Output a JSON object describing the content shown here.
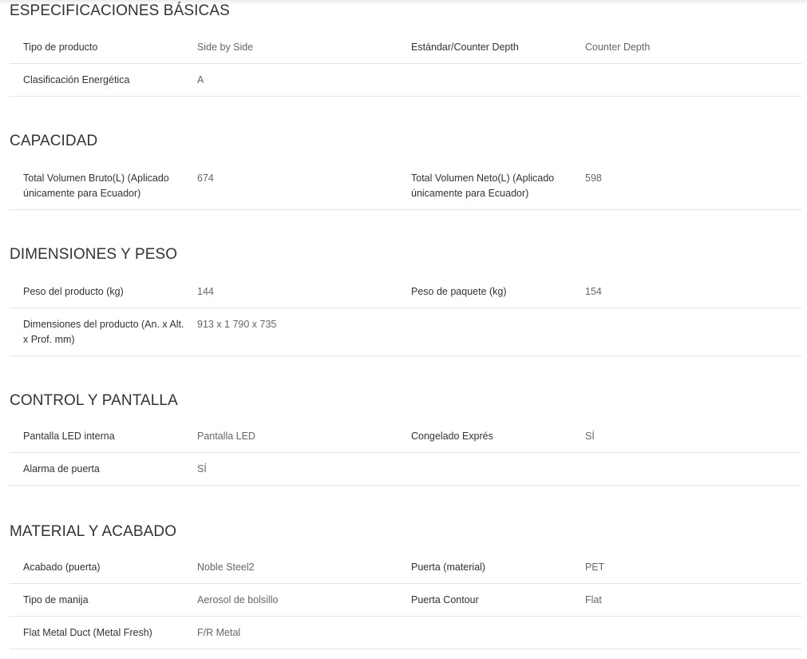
{
  "sections": [
    {
      "title": "ESPECIFICACIONES BÁSICAS",
      "rows": [
        {
          "l1": "Tipo de producto",
          "v1": "Side by Side",
          "l2": "Estándar/Counter Depth",
          "v2": "Counter Depth"
        },
        {
          "l1": "Clasificación Energética",
          "v1": "A"
        }
      ]
    },
    {
      "title": "CAPACIDAD",
      "rows": [
        {
          "l1": "Total Volumen Bruto(L) (Aplicado únicamente para Ecuador)",
          "v1": "674",
          "l2": "Total Volumen Neto(L) (Aplicado únicamente para Ecuador)",
          "v2": "598"
        }
      ]
    },
    {
      "title": "DIMENSIONES Y PESO",
      "rows": [
        {
          "l1": "Peso del producto (kg)",
          "v1": "144",
          "l2": "Peso de paquete (kg)",
          "v2": "154"
        },
        {
          "l1": "Dimensiones del producto (An. x Alt. x Prof. mm)",
          "v1": "913 x 1 790 x 735"
        }
      ]
    },
    {
      "title": "CONTROL Y PANTALLA",
      "rows": [
        {
          "l1": "Pantalla LED interna",
          "v1": "Pantalla LED",
          "l2": "Congelado Exprés",
          "v2": "SÍ"
        },
        {
          "l1": "Alarma de puerta",
          "v1": "SÍ"
        }
      ]
    },
    {
      "title": "MATERIAL Y ACABADO",
      "rows": [
        {
          "l1": "Acabado (puerta)",
          "v1": "Noble Steel2",
          "l2": "Puerta (material)",
          "v2": "PET"
        },
        {
          "l1": "Tipo de manija",
          "v1": "Aerosol de bolsillo",
          "l2": "Puerta Contour",
          "v2": "Flat"
        },
        {
          "l1": "Flat Metal Duct (Metal Fresh)",
          "v1": "F/R Metal"
        }
      ]
    }
  ]
}
